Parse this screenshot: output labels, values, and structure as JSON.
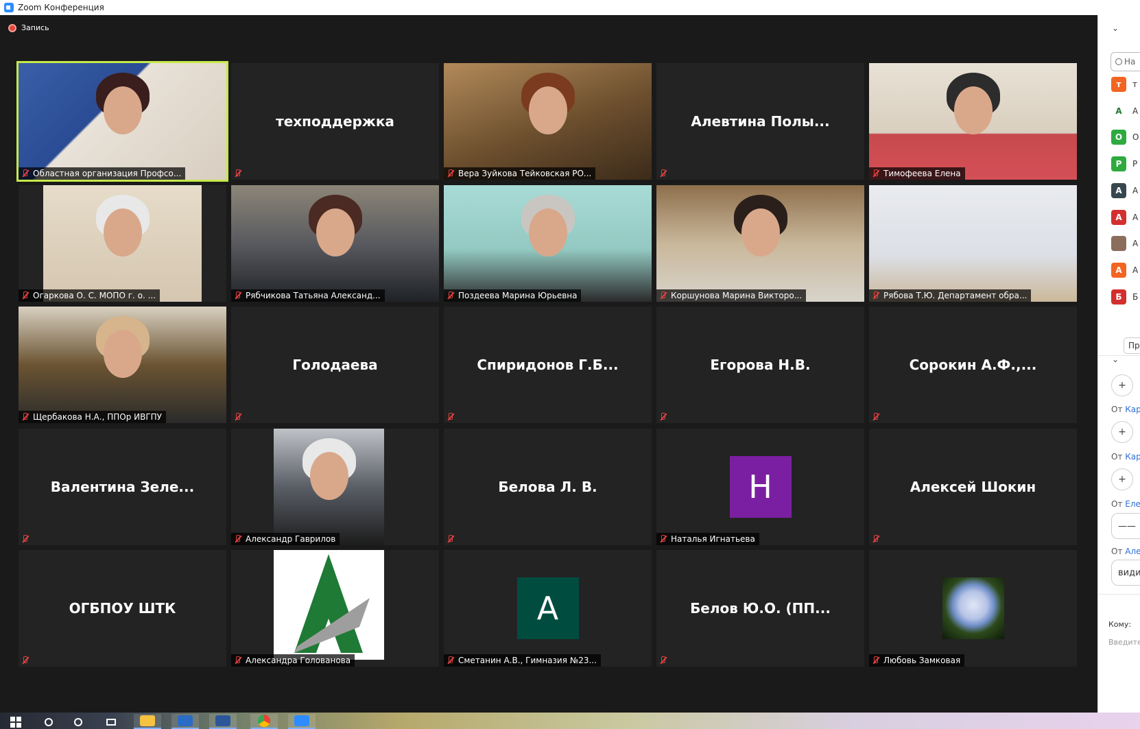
{
  "window": {
    "title": "Zoom Конференция"
  },
  "recording": {
    "label": "Запись"
  },
  "participants": [
    {
      "name": "",
      "caption": "Областная организация Профсо...",
      "video": true,
      "active": true
    },
    {
      "name": "техподдержка",
      "caption": ""
    },
    {
      "name": "",
      "caption": "Вера Зуйкова Тейковская РО...",
      "video": true
    },
    {
      "name": "Алевтина  Полы...",
      "caption": ""
    },
    {
      "name": "",
      "caption": "Тимофеева Елена",
      "video": true
    },
    {
      "name": "",
      "caption": "Огаркова О. С. МОПО г. о. ...",
      "video": true
    },
    {
      "name": "",
      "caption": "Рябчикова Татьяна Александ...",
      "video": true
    },
    {
      "name": "",
      "caption": "Поздеева Марина Юрьевна",
      "video": true
    },
    {
      "name": "",
      "caption": "Коршунова Марина Викторо...",
      "video": true
    },
    {
      "name": "",
      "caption": "Рябова Т.Ю. Департамент обра...",
      "video": true
    },
    {
      "name": "",
      "caption": "Щербакова Н.А., ППОр ИВГПУ",
      "video": true
    },
    {
      "name": "Голодаева",
      "caption": ""
    },
    {
      "name": "Спиридонов  Г.Б...",
      "caption": ""
    },
    {
      "name": "Егорова Н.В.",
      "caption": ""
    },
    {
      "name": "Сорокин  А.Ф.,...",
      "caption": ""
    },
    {
      "name": "Валентина  Зеле...",
      "caption": ""
    },
    {
      "name": "",
      "caption": "Александр Гаврилов",
      "video": true
    },
    {
      "name": "Белова Л. В.",
      "caption": ""
    },
    {
      "name": "",
      "caption": "Наталья Игнатьева",
      "avatar_letter": "Н",
      "avatar_color": "#7b1fa2"
    },
    {
      "name": "Алексей Шокин",
      "caption": ""
    },
    {
      "name": "ОГБПОУ ШТК",
      "caption": ""
    },
    {
      "name": "",
      "caption": "Александра Голованова",
      "logo": true
    },
    {
      "name": "",
      "caption": "Сметанин А.В., Гимназия №23...",
      "avatar_letter": "А",
      "avatar_color": "#004d40"
    },
    {
      "name": "Белов Ю.О. (ПП...",
      "caption": ""
    },
    {
      "name": "",
      "caption": "Любовь Замковая",
      "flower": true
    }
  ],
  "right_panel": {
    "search_placeholder": "На",
    "participant_initials": [
      {
        "letter": "т",
        "color": "#f26522",
        "text": "т"
      },
      {
        "letter": "",
        "color": "#ffffff",
        "text": "А"
      },
      {
        "letter": "О",
        "color": "#2eaa3f",
        "text": "О"
      },
      {
        "letter": "Р",
        "color": "#2eaa3f",
        "text": "Р"
      },
      {
        "letter": "А",
        "color": "#37474f",
        "text": "А"
      },
      {
        "letter": "А",
        "color": "#d32f2f",
        "text": "А"
      },
      {
        "letter": "",
        "color": "#8a6d5a",
        "text": "А"
      },
      {
        "letter": "А",
        "color": "#f26522",
        "text": "А"
      },
      {
        "letter": "Б",
        "color": "#d32f2f",
        "text": "Б"
      }
    ],
    "pr_button": "Пр",
    "chat": [
      {
        "from_label": "От",
        "from_name": "Кар"
      },
      {
        "from_label": "От",
        "from_name": "Кар"
      },
      {
        "from_label": "От",
        "from_name": "Елен"
      },
      {
        "from_label": "От",
        "from_name": "Алек"
      }
    ],
    "msg_line": "——",
    "msg_text": "види",
    "to_label": "Кому:",
    "input_placeholder": "Введите"
  }
}
